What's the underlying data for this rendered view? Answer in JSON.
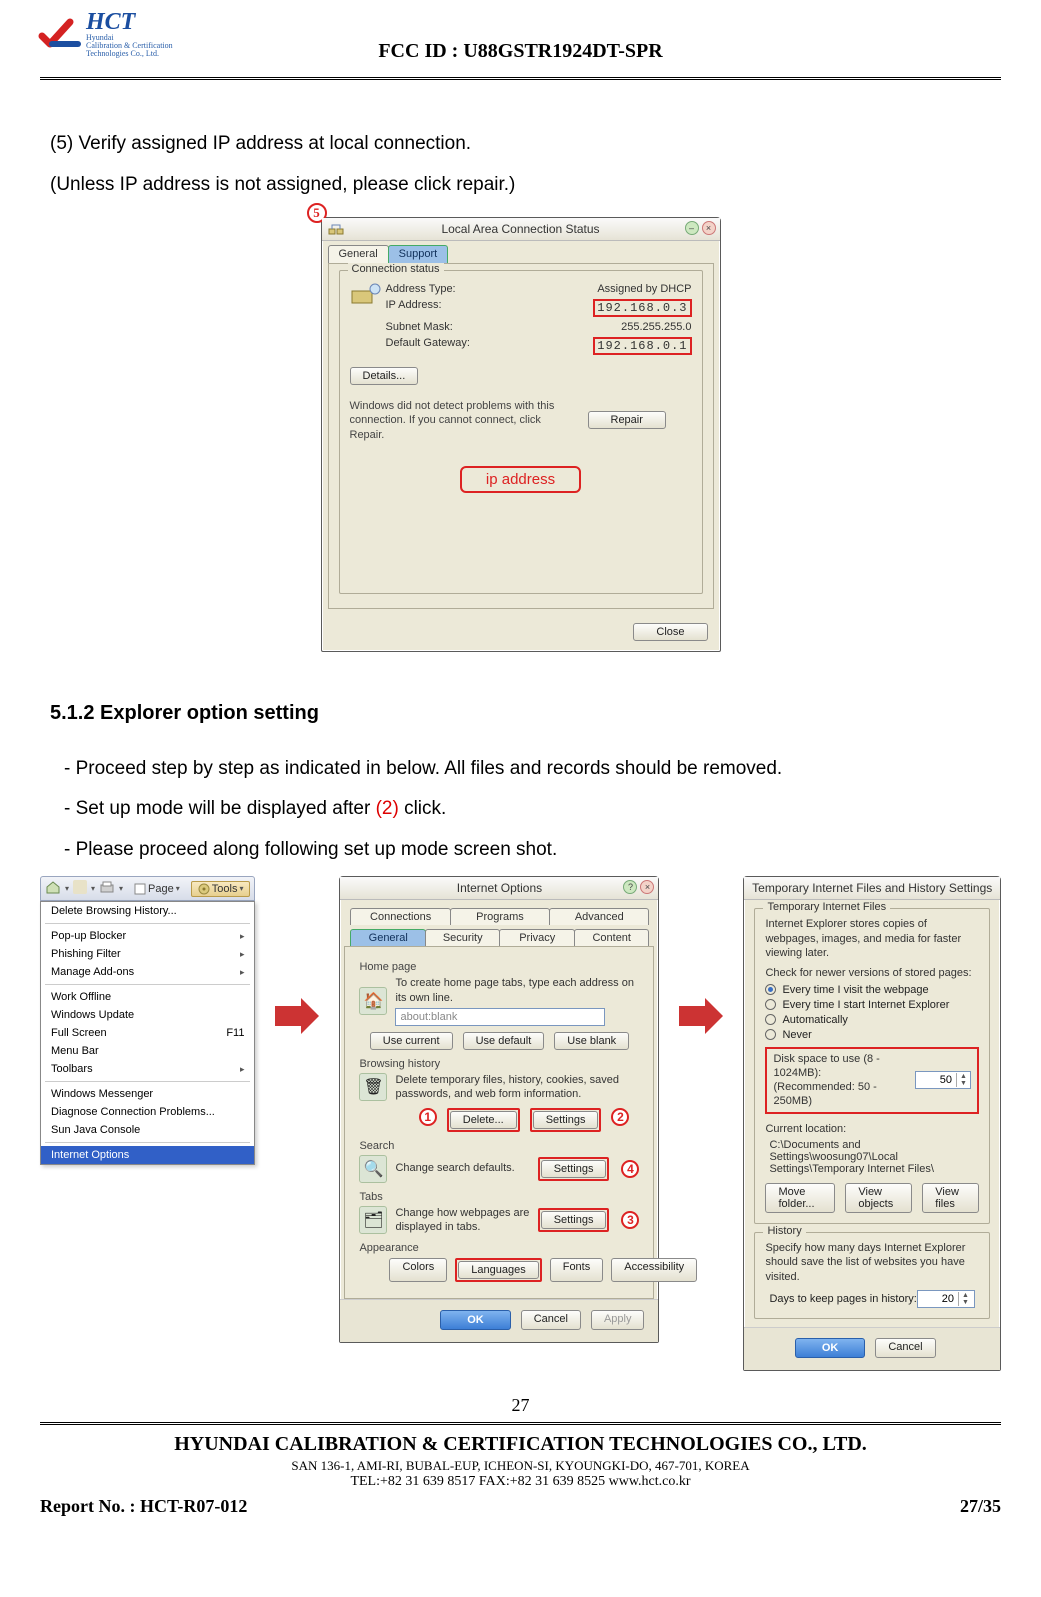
{
  "header": {
    "logo_name": "HCT",
    "logo_sub1": "Hyundai",
    "logo_sub2": "Calibration & Certification",
    "logo_sub3": "Technologies Co., Ltd.",
    "fcc_id": "FCC ID : U88GSTR1924DT-SPR"
  },
  "body": {
    "para1": "(5) Verify assigned IP address at local connection.",
    "para2": "(Unless IP address is not assigned, please click repair.)",
    "section_title": "5.1.2 Explorer option setting",
    "bullet1": "- Proceed step by step as indicated in below. All files and records should be removed.",
    "bullet2_pre": "- Set up mode will be displayed after ",
    "bullet2_num": "(2)",
    "bullet2_post": " click.",
    "bullet3": "- Please proceed along following set up mode screen shot."
  },
  "dlg_status": {
    "title": "Local Area Connection Status",
    "tab_general": "General",
    "tab_support": "Support",
    "group_title": "Connection status",
    "k_addr_type": "Address Type:",
    "v_addr_type": "Assigned by DHCP",
    "k_ip": "IP Address:",
    "v_ip": "192.168.0.3",
    "k_subnet": "Subnet Mask:",
    "v_subnet": "255.255.255.0",
    "k_gateway": "Default Gateway:",
    "v_gateway": "192.168.0.1",
    "btn_details": "Details...",
    "note": "Windows did not detect problems with this connection. If you cannot connect, click Repair.",
    "btn_repair": "Repair",
    "ip_label": "ip address",
    "btn_close": "Close",
    "callout_num": "5"
  },
  "ie_menu": {
    "toolbar_page": "Page",
    "toolbar_tools": "Tools",
    "items": [
      "Delete Browsing History...",
      "Pop-up Blocker",
      "Phishing Filter",
      "Manage Add-ons",
      "Work Offline",
      "Windows Update",
      "Full Screen",
      "Menu Bar",
      "Toolbars",
      "Windows Messenger",
      "Diagnose Connection Problems...",
      "Sun Java Console",
      "Internet Options"
    ],
    "full_screen_shortcut": "F11",
    "submenu_marker": "▸"
  },
  "internet_options": {
    "title": "Internet Options",
    "tabs_row1": [
      "Connections",
      "Programs",
      "Advanced"
    ],
    "tabs_row2": [
      "General",
      "Security",
      "Privacy",
      "Content"
    ],
    "active_tab": "General",
    "home_page_label": "Home page",
    "home_page_text": "To create home page tabs, type each address on its own line.",
    "home_page_value": "about:blank",
    "btn_use_current": "Use current",
    "btn_use_default": "Use default",
    "btn_use_blank": "Use blank",
    "browsing_history_label": "Browsing history",
    "browsing_history_text": "Delete temporary files, history, cookies, saved passwords, and web form information.",
    "btn_delete": "Delete...",
    "btn_settings": "Settings",
    "search_label": "Search",
    "search_text": "Change search defaults.",
    "tabs_label": "Tabs",
    "tabs_text": "Change how webpages are displayed in tabs.",
    "appearance_label": "Appearance",
    "btn_colors": "Colors",
    "btn_languages": "Languages",
    "btn_fonts": "Fonts",
    "btn_accessibility": "Accessibility",
    "btn_ok": "OK",
    "btn_cancel": "Cancel",
    "btn_apply": "Apply",
    "circ1": "1",
    "circ2": "2",
    "circ3": "3",
    "circ4": "4"
  },
  "temp_files": {
    "title": "Temporary Internet Files and History Settings",
    "group1_title": "Temporary Internet Files",
    "intro_text": "Internet Explorer stores copies of webpages, images, and media for faster viewing later.",
    "check_label": "Check for newer versions of stored pages:",
    "opt1": "Every time I visit the webpage",
    "opt2": "Every time I start Internet Explorer",
    "opt3": "Automatically",
    "opt4": "Never",
    "disk_label": "Disk space to use (8 - 1024MB):",
    "disk_recommend": "(Recommended: 50 - 250MB)",
    "disk_value": "50",
    "loc_label": "Current location:",
    "loc_path": "C:\\Documents and Settings\\woosung07\\Local Settings\\Temporary Internet Files\\",
    "btn_move": "Move folder...",
    "btn_view_obj": "View objects",
    "btn_view_files": "View files",
    "group2_title": "History",
    "history_text": "Specify how many days Internet Explorer should save the list of websites you have visited.",
    "history_days_label": "Days to keep pages in history:",
    "history_days_value": "20",
    "btn_ok": "OK",
    "btn_cancel": "Cancel"
  },
  "footer": {
    "page_num": "27",
    "company": "HYUNDAI CALIBRATION & CERTIFICATION TECHNOLOGIES CO., LTD.",
    "address": "SAN 136-1, AMI-RI, BUBAL-EUP, ICHEON-SI, KYOUNGKI-DO, 467-701, KOREA",
    "contact": "TEL:+82 31 639 8517    FAX:+82 31 639 8525    www.hct.co.kr",
    "report_label": "Report No. :  HCT-R07-012",
    "page_of": "27/35"
  }
}
